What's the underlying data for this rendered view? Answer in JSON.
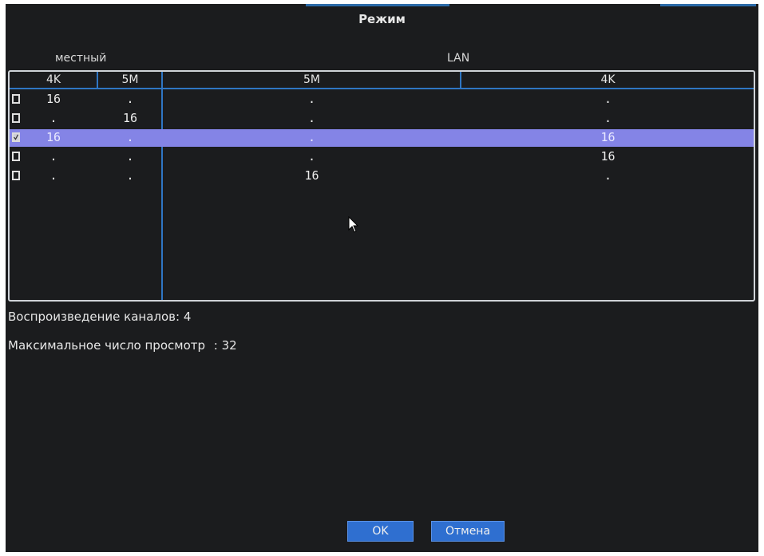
{
  "dialog": {
    "title": "Режим"
  },
  "groups": {
    "local": "местный",
    "lan": "LAN"
  },
  "columns": {
    "local_4k": "4K",
    "local_5m": "5M",
    "lan_5m": "5M",
    "lan_4k": "4K"
  },
  "rows": [
    {
      "checked": false,
      "local_4k": "16",
      "local_5m": ".",
      "lan_5m": ".",
      "lan_4k": "."
    },
    {
      "checked": false,
      "local_4k": ".",
      "local_5m": "16",
      "lan_5m": ".",
      "lan_4k": "."
    },
    {
      "checked": true,
      "local_4k": "16",
      "local_5m": ".",
      "lan_5m": ".",
      "lan_4k": "16"
    },
    {
      "checked": false,
      "local_4k": ".",
      "local_5m": ".",
      "lan_5m": ".",
      "lan_4k": "16"
    },
    {
      "checked": false,
      "local_4k": ".",
      "local_5m": ".",
      "lan_5m": "16",
      "lan_4k": "."
    }
  ],
  "info": {
    "playback_label": "Воспроизведение каналов:",
    "playback_value": "4",
    "max_label": "Максимальное число просмотр",
    "max_value": ": 32"
  },
  "buttons": {
    "ok": "OK",
    "cancel": "Отмена"
  },
  "colors": {
    "background": "#1b1c1e",
    "accent": "#2f76c4",
    "selected_row": "#8484e6",
    "button": "#2f6fd0"
  }
}
